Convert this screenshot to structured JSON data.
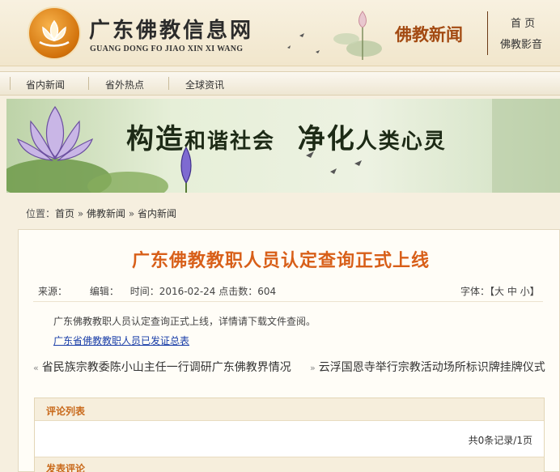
{
  "header": {
    "site_title": "广东佛教信息网",
    "site_subtitle": "GUANG DONG FO JIAO XIN XI WANG",
    "section_name": "佛教新闻",
    "links": {
      "home": "首 页",
      "video": "佛教影音"
    }
  },
  "nav": {
    "items": [
      "省内新闻",
      "省外热点",
      "全球资讯"
    ]
  },
  "banner": {
    "slogan_part1_big": "构造",
    "slogan_part1_small": "和谐社会",
    "slogan_part2_big": "净化",
    "slogan_part2_small": "人类心灵"
  },
  "breadcrumb": {
    "label": "位置：",
    "home": "首页",
    "sep": " » ",
    "news": "佛教新闻",
    "current": "省内新闻"
  },
  "article": {
    "title": "广东佛教教职人员认定查询正式上线",
    "source_label": "来源：",
    "editor_label": "编辑：",
    "time": "时间：2016-02-24 点击数：604",
    "font_size_label": "字体：【大 中 小】",
    "body": "广东佛教教职人员认定查询正式上线，详情请下载文件查阅。",
    "download_link": "广东省佛教教职人员已发证总表",
    "prev": "省民族宗教委陈小山主任一行调研广东佛教界情况",
    "next": "云浮国恩寺举行宗教活动场所标识牌挂牌仪式"
  },
  "comments": {
    "list_title": "评论列表",
    "record_count": "共0条记录/1页",
    "post_title": "发表评论"
  },
  "colors": {
    "accent": "#d85f19",
    "section": "#a34a12",
    "link": "#1a3ea8"
  }
}
